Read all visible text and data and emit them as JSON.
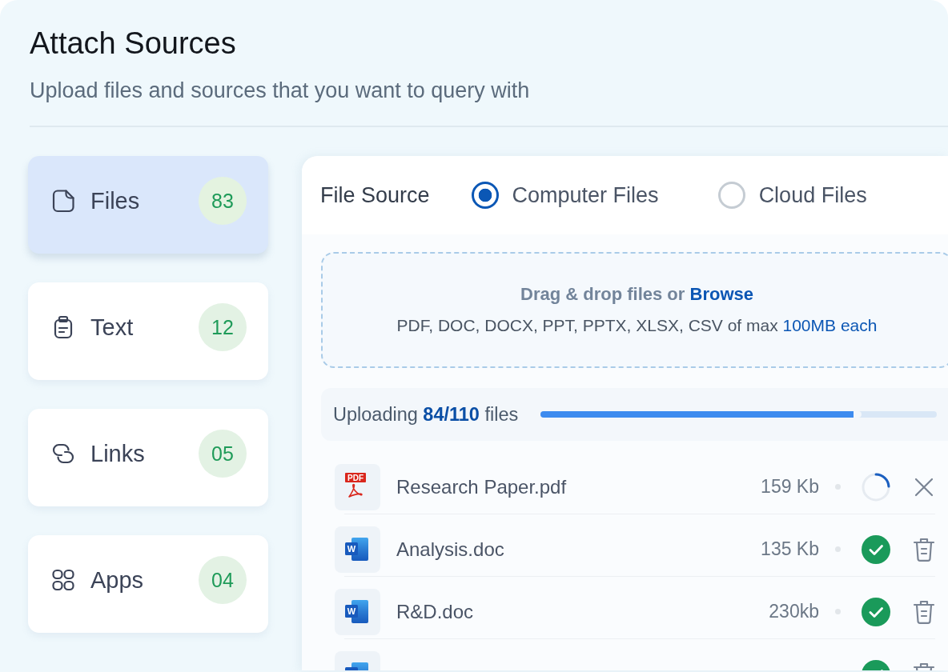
{
  "header": {
    "title": "Attach Sources",
    "subtitle": "Upload files and sources that you want to query with"
  },
  "sidebar": {
    "items": [
      {
        "kind": "files",
        "label": "Files",
        "count": "83",
        "selected": true
      },
      {
        "kind": "text",
        "label": "Text",
        "count": "12",
        "selected": false
      },
      {
        "kind": "links",
        "label": "Links",
        "count": "05",
        "selected": false
      },
      {
        "kind": "apps",
        "label": "Apps",
        "count": "04",
        "selected": false
      }
    ]
  },
  "file_source": {
    "label": "File Source",
    "options": [
      {
        "label": "Computer Files",
        "selected": true
      },
      {
        "label": "Cloud Files",
        "selected": false
      }
    ]
  },
  "dropzone": {
    "prompt": "Drag & drop files or",
    "link": "Browse",
    "hint": "PDF, DOC, DOCX, PPT, PPTX, XLSX, CSV of max",
    "hint_highlight": "100MB each"
  },
  "upload": {
    "status": "Uploading **84/110** files",
    "level": 0.81
  },
  "files": [
    {
      "kind": "pdf",
      "type_label": "PDF",
      "name": "Research Paper.pdf",
      "size": "159 Kb",
      "uploaded": false
    },
    {
      "kind": "word",
      "type_label": "W",
      "name": "Analysis.doc",
      "size": "135 Kb",
      "uploaded": true
    },
    {
      "kind": "word",
      "type_label": "W",
      "name": "R&D.doc",
      "size": "230kb",
      "uploaded": true
    },
    {
      "kind": "word",
      "uploaded": true
    }
  ]
}
